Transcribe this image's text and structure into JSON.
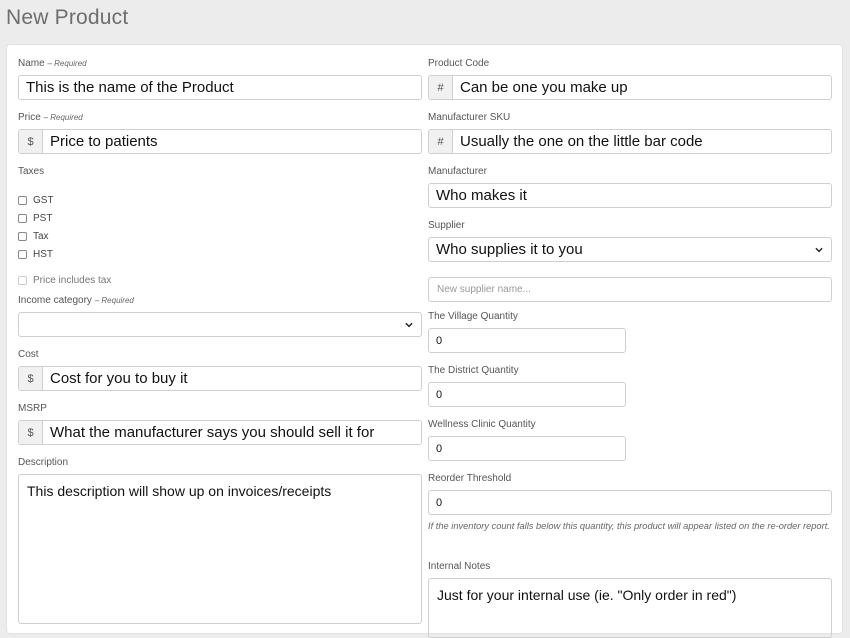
{
  "page": {
    "title": "New Product"
  },
  "left": {
    "name": {
      "label": "Name",
      "required": "– Required",
      "value": "This is the name of the Product"
    },
    "price": {
      "label": "Price",
      "required": "– Required",
      "addon": "$",
      "value": "Price to patients"
    },
    "taxes": {
      "label": "Taxes",
      "options": [
        "GST",
        "PST",
        "Tax",
        "HST"
      ],
      "includes_tax": "Price includes tax"
    },
    "income_category": {
      "label": "Income category",
      "required": "– Required",
      "value": ""
    },
    "cost": {
      "label": "Cost",
      "addon": "$",
      "value": "Cost for you to buy it"
    },
    "msrp": {
      "label": "MSRP",
      "addon": "$",
      "value": "What the manufacturer says you should sell it for"
    },
    "description": {
      "label": "Description",
      "value": "This description will show up on invoices/receipts"
    }
  },
  "right": {
    "product_code": {
      "label": "Product Code",
      "addon": "#",
      "value": "Can be one you make up"
    },
    "manufacturer_sku": {
      "label": "Manufacturer SKU",
      "addon": "#",
      "value": "Usually the one on the little bar code"
    },
    "manufacturer": {
      "label": "Manufacturer",
      "value": "Who makes it"
    },
    "supplier": {
      "label": "Supplier",
      "value": "Who supplies it to you"
    },
    "new_supplier": {
      "placeholder": "New supplier name..."
    },
    "village_qty": {
      "label": "The Village Quantity",
      "value": "0"
    },
    "district_qty": {
      "label": "The District Quantity",
      "value": "0"
    },
    "wellness_qty": {
      "label": "Wellness Clinic Quantity",
      "value": "0"
    },
    "reorder": {
      "label": "Reorder Threshold",
      "value": "0",
      "help": "If the inventory count falls below this quantity, this product will appear listed on the re-order report."
    },
    "internal_notes": {
      "label": "Internal Notes",
      "value": "Just for your internal use (ie. \"Only order in red\")"
    }
  }
}
